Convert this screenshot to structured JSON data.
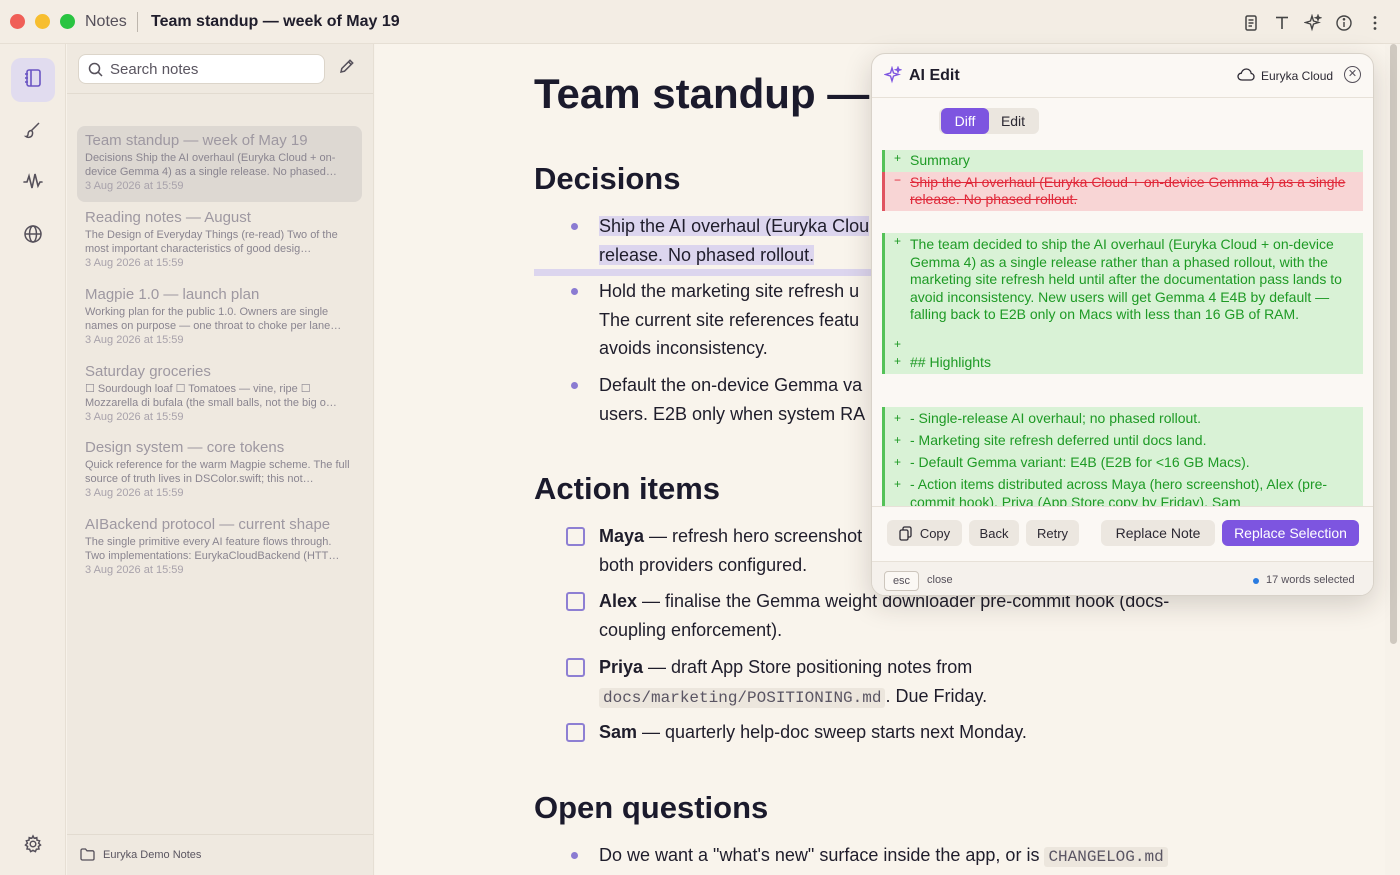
{
  "titlebar": {
    "app": "Notes",
    "title": "Team standup — week of May 19"
  },
  "sidebar": {
    "search_placeholder": "Search notes",
    "notes": [
      {
        "title": "Team standup — week of May 19",
        "snippet": "Decisions Ship the AI overhaul (Euryka Cloud + on-device Gemma 4) as a single release. No phased…",
        "date": "3 Aug 2026 at 15:59"
      },
      {
        "title": "Reading notes — August",
        "snippet": "The Design of Everyday Things (re-read) Two of the most important characteristics of good desig…",
        "date": "3 Aug 2026 at 15:59"
      },
      {
        "title": "Magpie 1.0 — launch plan",
        "snippet": "Working plan for the public 1.0. Owners are single names on purpose — one throat to choke per lane…",
        "date": "3 Aug 2026 at 15:59"
      },
      {
        "title": "Saturday groceries",
        "snippet": "☐ Sourdough loaf ☐ Tomatoes — vine, ripe ☐ Mozzarella di bufala (the small balls, not the big o…",
        "date": "3 Aug 2026 at 15:59"
      },
      {
        "title": "Design system — core tokens",
        "snippet": "Quick reference for the warm Magpie scheme. The full source of truth lives in DSColor.swift; this not…",
        "date": "3 Aug 2026 at 15:59"
      },
      {
        "title": "AIBackend protocol — current shape",
        "snippet": "The single primitive every AI feature flows through. Two implementations: EurykaCloudBackend (HTT…",
        "date": "3 Aug 2026 at 15:59"
      }
    ],
    "footer_folder": "Euryka Demo Notes"
  },
  "editor": {
    "title": "Team standup — w",
    "sections": {
      "decisions": "Decisions",
      "action_items": "Action items",
      "open_questions": "Open questions"
    },
    "decisions": {
      "item1_line1": "Ship the AI overhaul (Euryka Clou",
      "item1_line2": "release. No phased rollout.",
      "item2_line1": "Hold the marketing site refresh u",
      "item2_line2": "The current site references featu",
      "item2_line3": "avoids inconsistency.",
      "item3_line1": "Default the on-device Gemma va",
      "item3_line2": "users. E2B only when system RA"
    },
    "actions": [
      {
        "name": "Maya",
        "line1": " — refresh hero screenshot",
        "line2": "both providers configured."
      },
      {
        "name": "Alex",
        "line1": " — finalise the Gemma weight downloader pre-commit hook (docs-",
        "line2": "coupling enforcement)."
      },
      {
        "name": "Priya",
        "line1": " — draft App Store positioning notes from",
        "code": "docs/marketing/POSITIONING.md",
        "line2": ". Due Friday."
      },
      {
        "name": "Sam",
        "line1": " — quarterly help-doc sweep starts next Monday."
      }
    ],
    "question1": "Do we want a \"what's new\" surface inside the app, or is ",
    "question1_code": "CHANGELOG.md"
  },
  "ai_panel": {
    "title": "AI Edit",
    "provider": "Euryka Cloud",
    "tabs": {
      "diff": "Diff",
      "edit": "Edit"
    },
    "diff": {
      "summary": "Summary",
      "deleted": "Ship the AI overhaul (Euryka Cloud + on-device Gemma 4) as a single release. No phased rollout.",
      "para": "The team decided to ship the AI overhaul (Euryka Cloud + on-device Gemma 4) as a single release rather than a phased rollout, with the marketing site refresh held until after the documentation pass lands to avoid inconsistency. New users will get Gemma 4 E4B by default — falling back to E2B only on Macs with less than 16 GB of RAM.",
      "highlights": "## Highlights",
      "h1": "- Single-release AI overhaul; no phased rollout.",
      "h2": "- Marketing site refresh deferred until docs land.",
      "h3": "- Default Gemma variant: E4B (E2B for <16 GB Macs).",
      "h4": "- Action items distributed across Maya (hero screenshot), Alex (pre-commit hook), Priya (App Store copy by Friday), Sam"
    },
    "buttons": {
      "copy": "Copy",
      "back": "Back",
      "retry": "Retry",
      "replace_note": "Replace Note",
      "replace_selection": "Replace Selection"
    },
    "footer": {
      "key": "esc",
      "key_label": "close",
      "selection": "17 words selected"
    }
  },
  "colors": {
    "accent": "#7d55e0",
    "added": "#1e9a25",
    "removed": "#e0293a"
  }
}
